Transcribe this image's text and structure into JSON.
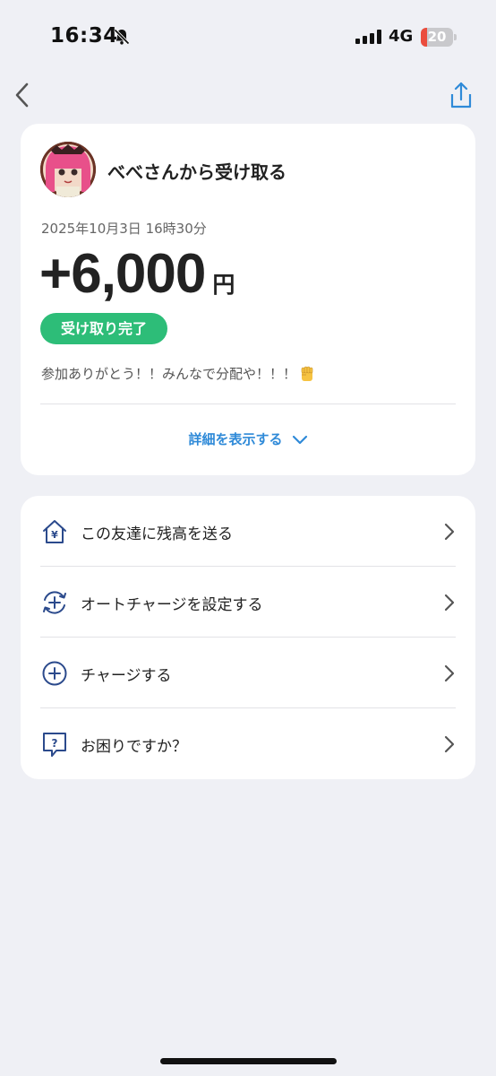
{
  "status_bar": {
    "time": "16:34",
    "network": "4G",
    "battery_level": "20",
    "battery_color": "#eb4d3d",
    "bell_icon": "bell-slash-icon"
  },
  "nav": {
    "back_icon": "chevron-left-icon",
    "share_icon": "share-icon",
    "icon_color": "#2f8ad8"
  },
  "transaction": {
    "sender_title": "べべさんから受け取る",
    "datetime": "2025年10月3日 16時30分",
    "amount": "+6,000",
    "currency": "円",
    "status": "受け取り完了",
    "status_color": "#2dbd78",
    "message": "参加ありがとう！！みんなで分配や！！！",
    "message_emoji": "raised-fist-emoji",
    "details_label": "詳細を表示する"
  },
  "menu": {
    "items": [
      {
        "label": "この友達に残高を送る",
        "icon": "house-yen-icon"
      },
      {
        "label": "オートチャージを設定する",
        "icon": "auto-charge-icon"
      },
      {
        "label": "チャージする",
        "icon": "plus-circle-icon"
      },
      {
        "label": "お困りですか？",
        "icon": "help-chat-icon"
      }
    ]
  }
}
